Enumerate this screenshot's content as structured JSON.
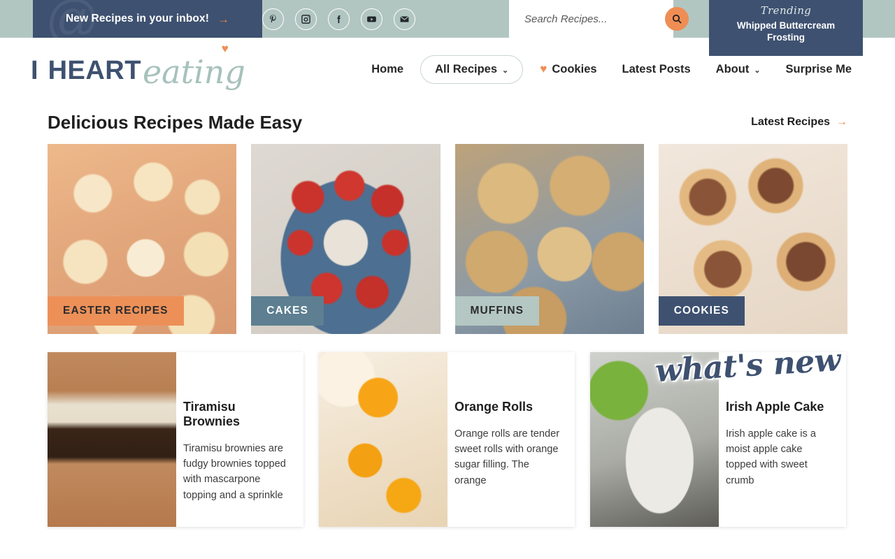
{
  "topbar": {
    "newsletter_label": "New Recipes in your inbox!",
    "newsletter_arrow": "→",
    "social": [
      {
        "name": "pinterest-icon",
        "label": "Pinterest"
      },
      {
        "name": "instagram-icon",
        "label": "Instagram"
      },
      {
        "name": "facebook-icon",
        "label": "Facebook"
      },
      {
        "name": "youtube-icon",
        "label": "YouTube"
      },
      {
        "name": "email-icon",
        "label": "Email"
      }
    ],
    "search": {
      "placeholder": "Search Recipes...",
      "value": "",
      "button_icon": "search-icon"
    },
    "trending": {
      "kicker": "Trending",
      "title": "Whipped Buttercream Frosting"
    }
  },
  "logo": {
    "word1": "I",
    "word2": "HEART",
    "script": "eating",
    "heart_glyph": "♥"
  },
  "nav": {
    "items": [
      {
        "label": "Home",
        "pill": false,
        "caret": false,
        "heart": false
      },
      {
        "label": "All Recipes",
        "pill": true,
        "caret": true,
        "caret_glyph": "⌄",
        "heart": false
      },
      {
        "label": "Cookies",
        "pill": false,
        "caret": false,
        "heart": true,
        "heart_glyph": "♥"
      },
      {
        "label": "Latest Posts",
        "pill": false,
        "caret": false,
        "heart": false
      },
      {
        "label": "About",
        "pill": false,
        "caret": true,
        "caret_glyph": "⌄",
        "heart": false
      },
      {
        "label": "Surprise Me",
        "pill": false,
        "caret": false,
        "heart": false
      }
    ]
  },
  "section": {
    "title": "Delicious Recipes Made Easy",
    "link_label": "Latest Recipes",
    "link_arrow": "→"
  },
  "categories": [
    {
      "label": "EASTER RECIPES",
      "label_class": "lab-easter",
      "photo_class": "ph-easter",
      "color": "#ec9058"
    },
    {
      "label": "CAKES",
      "label_class": "lab-cakes",
      "photo_class": "ph-cake",
      "color": "#5d7f91"
    },
    {
      "label": "MUFFINS",
      "label_class": "lab-muffin",
      "photo_class": "ph-muffin",
      "color": "#b4c7c2"
    },
    {
      "label": "COOKIES",
      "label_class": "lab-cookie",
      "photo_class": "ph-cookie",
      "color": "#3e5170"
    }
  ],
  "whats_new": {
    "heading": "what's new"
  },
  "recipes": [
    {
      "title": "Tiramisu Brownies",
      "description": "Tiramisu brownies are fudgy brownies topped with mascarpone topping and a sprinkle",
      "photo_class": "ph-tiramisu"
    },
    {
      "title": "Orange Rolls",
      "description": "Orange rolls are tender sweet rolls with orange sugar filling. The orange",
      "photo_class": "ph-orange"
    },
    {
      "title": "Irish Apple Cake",
      "description": "Irish apple cake is a moist apple cake topped with sweet crumb",
      "photo_class": "ph-apple"
    }
  ]
}
